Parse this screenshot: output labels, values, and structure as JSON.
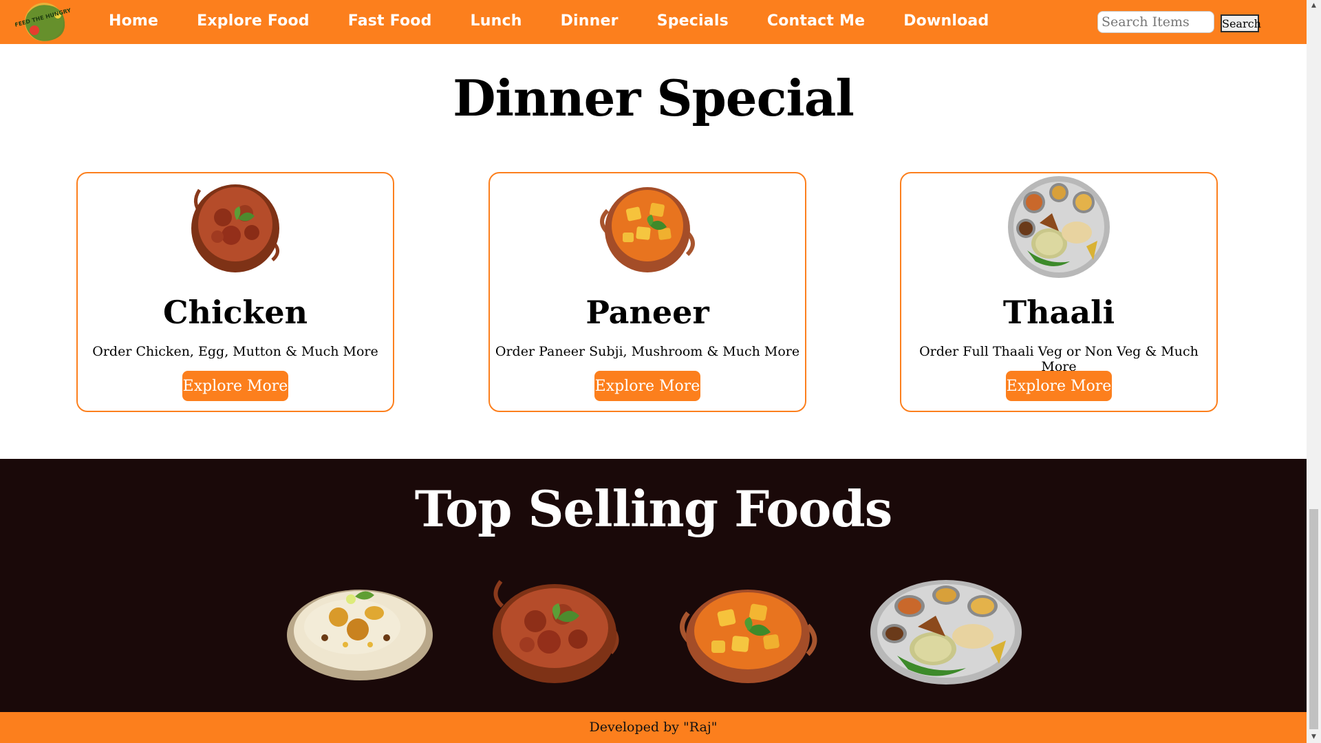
{
  "nav": {
    "logo_text": "FEED THE HUNGRY",
    "links": [
      "Home",
      "Explore Food",
      "Fast Food",
      "Lunch",
      "Dinner",
      "Specials",
      "Contact Me",
      "Download"
    ],
    "search_placeholder": "Search Items",
    "search_button": "Search"
  },
  "dinner": {
    "title": "Dinner Special",
    "cards": [
      {
        "name": "Chicken",
        "description": "Order Chicken, Egg, Mutton & Much More",
        "button": "Explore More",
        "image": "chicken-curry-icon"
      },
      {
        "name": "Paneer",
        "description": "Order Paneer Subji, Mushroom & Much More",
        "button": "Explore More",
        "image": "paneer-curry-icon"
      },
      {
        "name": "Thaali",
        "description": "Order Full Thaali Veg or Non Veg & Much More",
        "button": "Explore More",
        "image": "thaali-plate-icon"
      }
    ]
  },
  "top_selling": {
    "title": "Top Selling Foods",
    "items": [
      "biryani-icon",
      "chicken-curry-icon",
      "paneer-curry-icon",
      "thaali-plate-icon"
    ]
  },
  "footer": {
    "text": "Developed by \"Raj\""
  },
  "colors": {
    "brand_orange": "#fc7f1d",
    "dark_section": "#1a0909",
    "white": "#ffffff"
  }
}
